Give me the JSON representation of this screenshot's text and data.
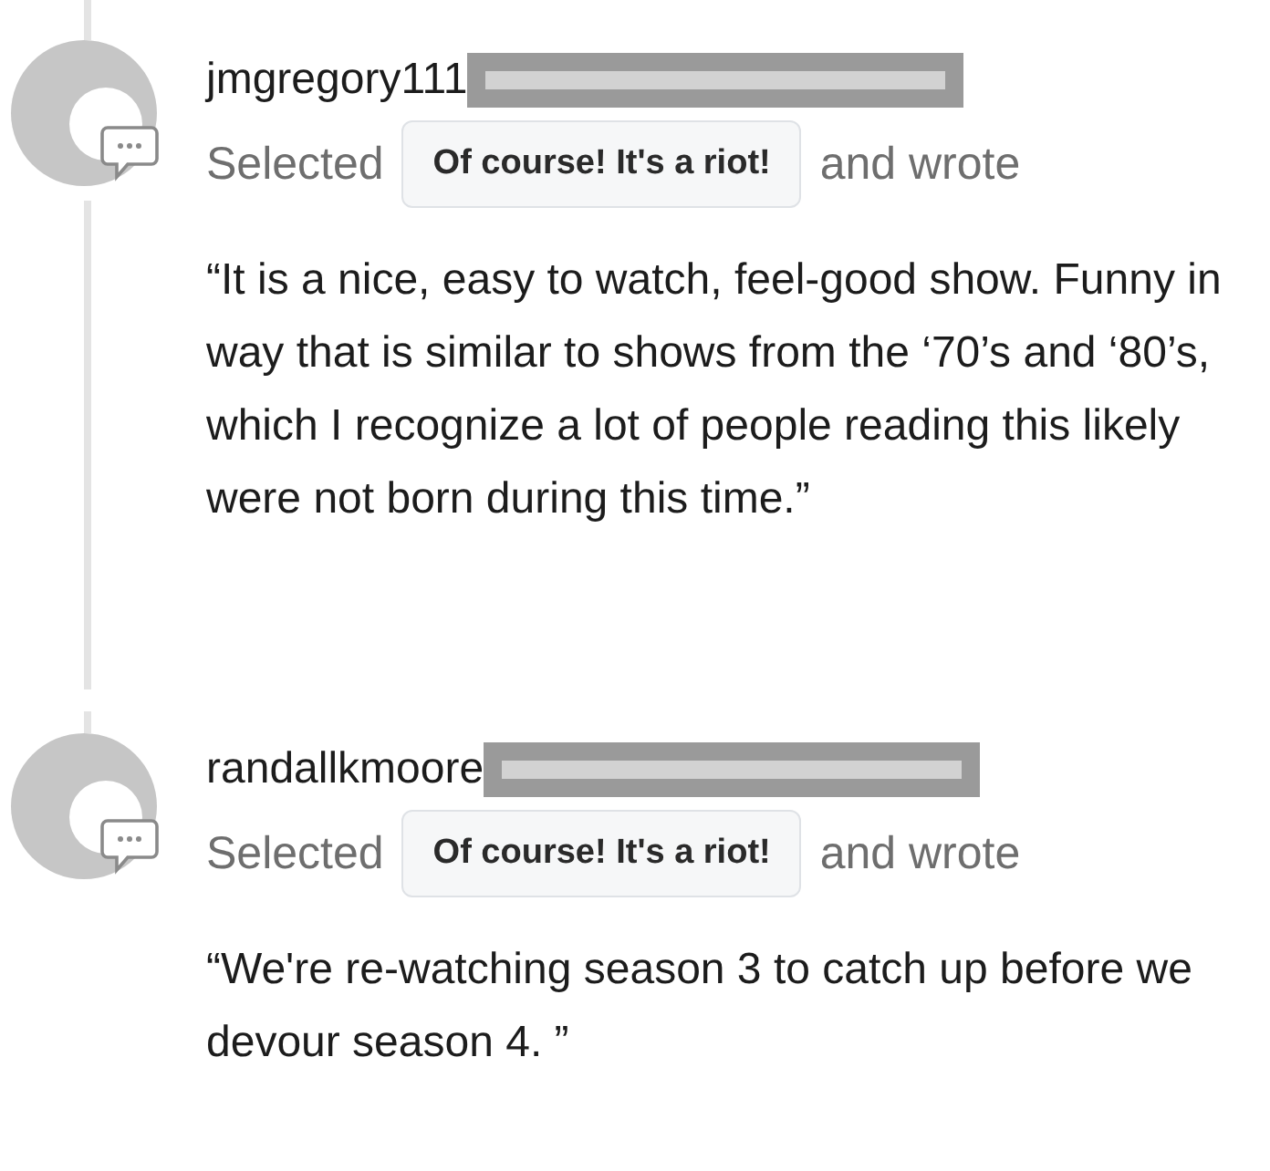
{
  "responses": [
    {
      "username": "jmgregory111",
      "action": "Selected",
      "choice": "Of course! It's a riot!",
      "suffix": "and wrote",
      "quote": "“It is a nice, easy to watch, feel-good show. Funny in way that is similar to shows from the ‘70’s and ‘80’s, which I recognize a lot of people reading this likely were not born during this time.”"
    },
    {
      "username": "randallkmoore",
      "action": "Selected",
      "choice": "Of course! It's a riot!",
      "suffix": "and wrote",
      "quote": "“We're re-watching season 3 to catch up before we devour season 4. ”"
    }
  ]
}
